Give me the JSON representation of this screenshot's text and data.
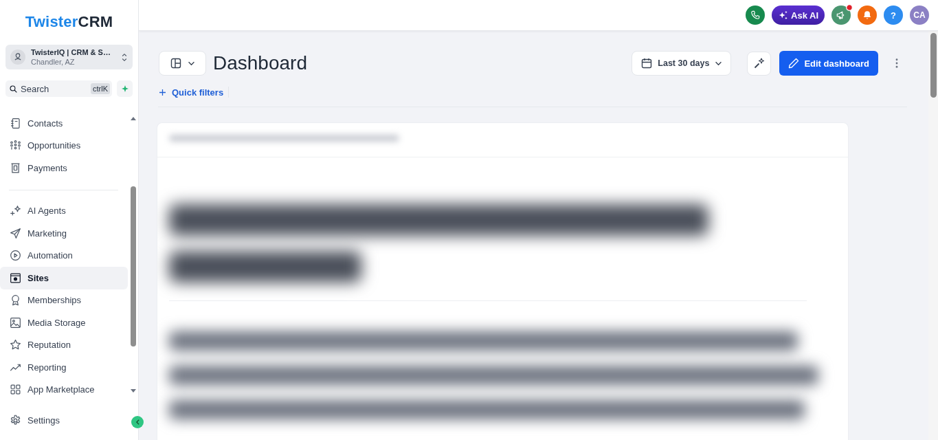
{
  "logo": {
    "first": "Twister",
    "second": "CRM"
  },
  "account": {
    "name": "TwisterIQ | CRM & S…",
    "location": "Chandler, AZ"
  },
  "search": {
    "placeholder": "Search",
    "shortcut": "ctrlK"
  },
  "nav_groups": [
    {
      "items": [
        {
          "label": "Contacts",
          "selected": false
        },
        {
          "label": "Opportunities",
          "selected": false
        },
        {
          "label": "Payments",
          "selected": false
        }
      ]
    },
    {
      "items": [
        {
          "label": "AI Agents",
          "selected": false
        },
        {
          "label": "Marketing",
          "selected": false
        },
        {
          "label": "Automation",
          "selected": false
        },
        {
          "label": "Sites",
          "selected": true
        },
        {
          "label": "Memberships",
          "selected": false
        },
        {
          "label": "Media Storage",
          "selected": false
        },
        {
          "label": "Reputation",
          "selected": false
        },
        {
          "label": "Reporting",
          "selected": false
        },
        {
          "label": "App Marketplace",
          "selected": false
        }
      ]
    }
  ],
  "settings": {
    "label": "Settings"
  },
  "top_bar": {
    "ask_ai": "Ask AI",
    "notification_dot": true,
    "help": "?",
    "avatar_initials": "CA"
  },
  "header": {
    "title": "Dashboard",
    "date_range": "Last 30 days",
    "edit_button": "Edit dashboard",
    "quick_filters": "Quick filters"
  }
}
